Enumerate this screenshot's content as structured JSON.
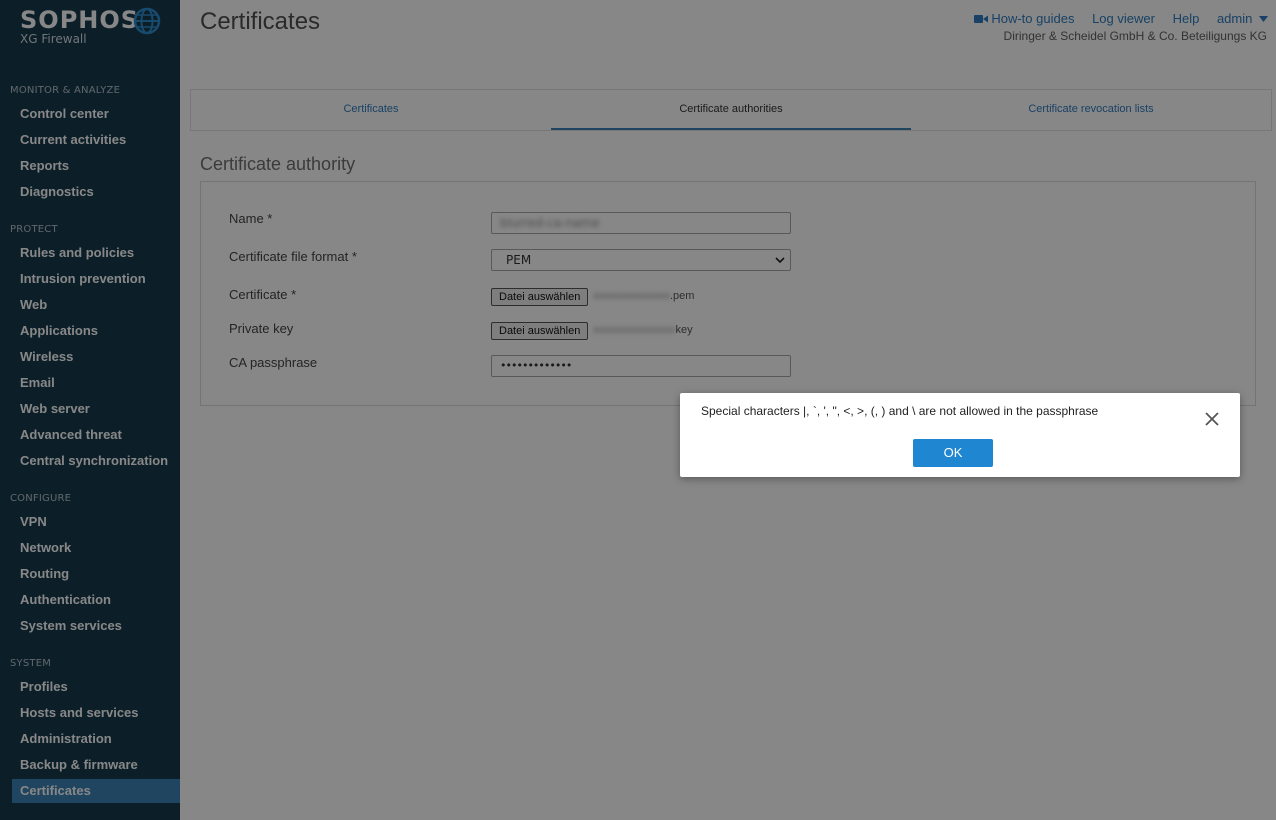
{
  "brand": {
    "name": "SOPHOS",
    "product": "XG Firewall"
  },
  "sidebar": {
    "sections": [
      {
        "label": "MONITOR & ANALYZE",
        "items": [
          "Control center",
          "Current activities",
          "Reports",
          "Diagnostics"
        ]
      },
      {
        "label": "PROTECT",
        "items": [
          "Rules and policies",
          "Intrusion prevention",
          "Web",
          "Applications",
          "Wireless",
          "Email",
          "Web server",
          "Advanced threat",
          "Central synchronization"
        ]
      },
      {
        "label": "CONFIGURE",
        "items": [
          "VPN",
          "Network",
          "Routing",
          "Authentication",
          "System services"
        ]
      },
      {
        "label": "SYSTEM",
        "items": [
          "Profiles",
          "Hosts and services",
          "Administration",
          "Backup & firmware",
          "Certificates"
        ]
      }
    ],
    "active_item": "Certificates"
  },
  "header": {
    "title": "Certificates",
    "links": {
      "howto": "How-to guides",
      "log": "Log viewer",
      "help": "Help",
      "user": "admin"
    },
    "company": "Diringer & Scheidel GmbH & Co. Beteiligungs KG"
  },
  "tabs": [
    {
      "label": "Certificates",
      "active": false
    },
    {
      "label": "Certificate authorities",
      "active": true
    },
    {
      "label": "Certificate revocation lists",
      "active": false
    }
  ],
  "form": {
    "section_title": "Certificate authority",
    "name_label": "Name *",
    "name_value": "blurred-ca-name",
    "format_label": "Certificate file format *",
    "format_value": "PEM",
    "cert_label": "Certificate *",
    "cert_button": "Datei auswählen",
    "cert_file_suffix": ".pem",
    "key_label": "Private key",
    "key_button": "Datei auswählen",
    "key_file_suffix": "key",
    "pass_label": "CA passphrase",
    "pass_value": "•••••••••••••"
  },
  "dialog": {
    "message": "Special characters |, `, ', \", <, >, (, ) and \\ are not allowed in the passphrase",
    "ok_label": "OK"
  },
  "colors": {
    "sidebar_bg": "#183c4f",
    "active": "#3d83b6",
    "link": "#2f7cbf",
    "ok_button": "#1f87d2"
  }
}
